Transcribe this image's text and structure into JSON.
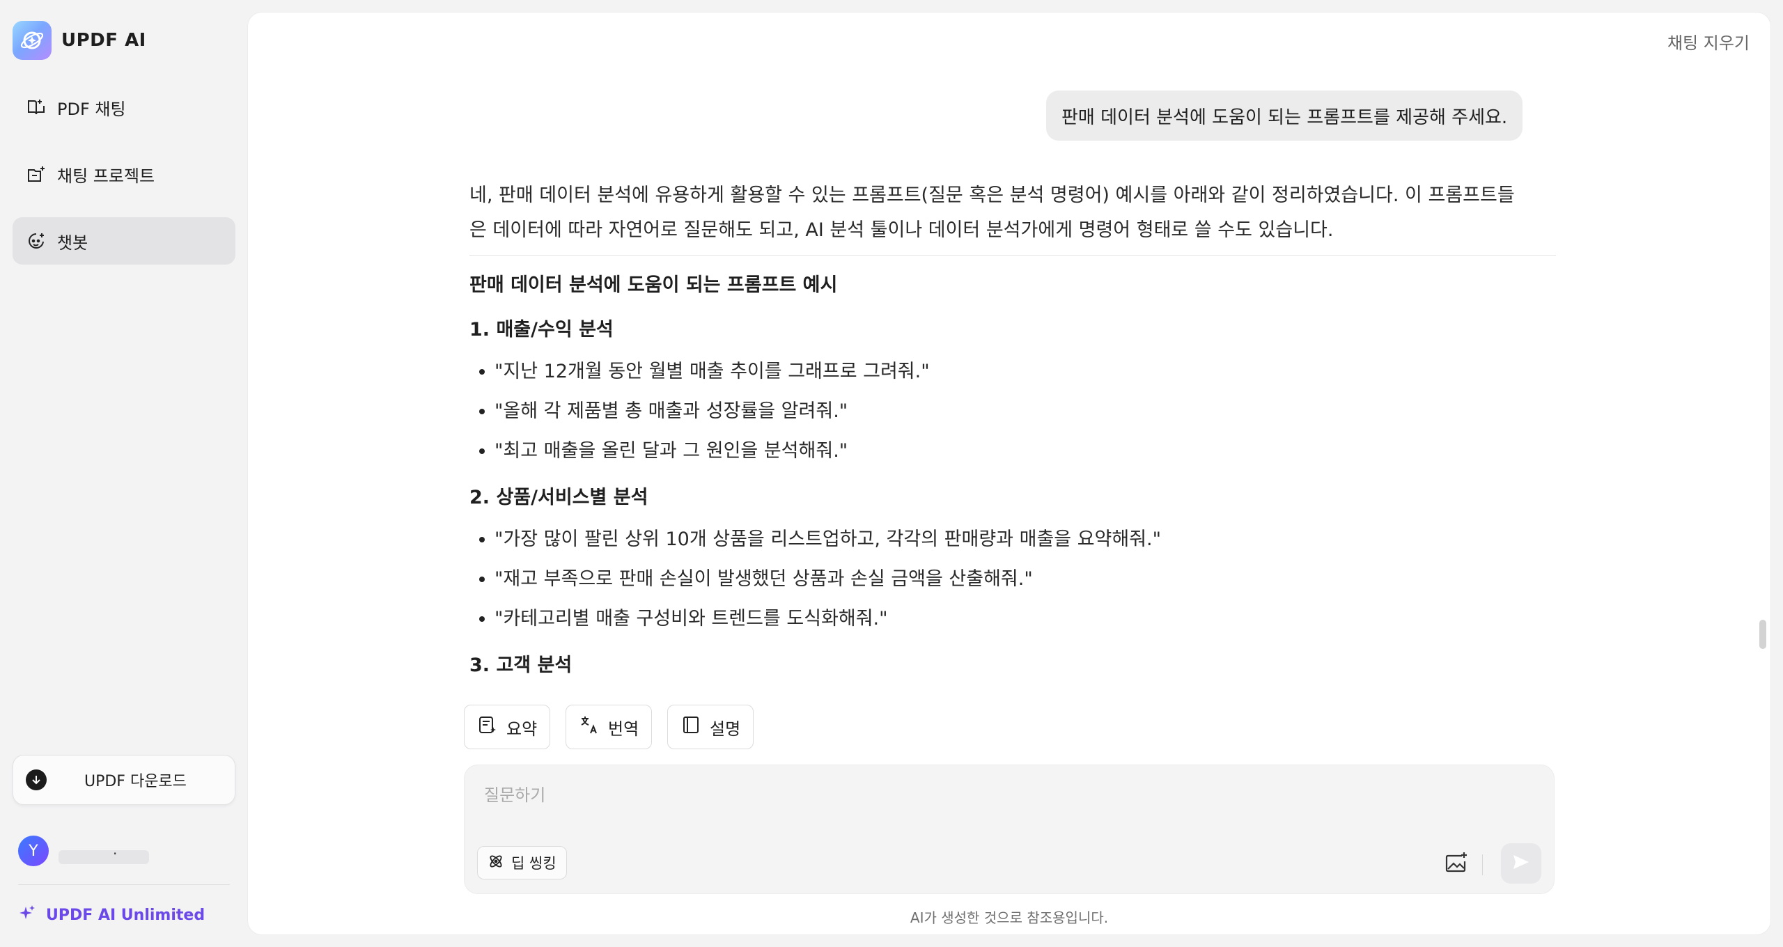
{
  "sidebar": {
    "brand": "UPDF AI",
    "nav": [
      {
        "label": "PDF 채팅",
        "icon": "book-open-icon"
      },
      {
        "label": "채팅 프로젝트",
        "icon": "folder-plus-icon"
      },
      {
        "label": "챗봇",
        "icon": "chatbot-icon",
        "active": true
      }
    ],
    "download_label": "UPDF 다운로드",
    "user": {
      "initial": "Y",
      "name_dot": "."
    },
    "unlimited_label": "UPDF AI Unlimited"
  },
  "header": {
    "clear_chat": "채팅 지우기"
  },
  "conversation": {
    "user_message": "판매 데이터 분석에 도움이 되는 프롬프트를 제공해 주세요.",
    "intro_line1": "네, 판매 데이터 분석에 유용하게 활용할 수 있는 프롬프트(질문 혹은 분석 명령어) 예시를 아래와 같이 정리하였습니다. 이 프롬프트들",
    "intro_line2": "은 데이터에 따라 자연어로 질문해도 되고, AI 분석 툴이나 데이터 분석가에게 명령어 형태로 쓸 수도 있습니다.",
    "title": "판매 데이터 분석에 도움이 되는 프롬프트 예시",
    "sections": [
      {
        "heading": "1. 매출/수익 분석",
        "items": [
          "\"지난 12개월 동안 월별 매출 추이를 그래프로 그려줘.\"",
          "\"올해 각 제품별 총 매출과 성장률을 알려줘.\"",
          "\"최고 매출을 올린 달과 그 원인을 분석해줘.\""
        ]
      },
      {
        "heading": "2. 상품/서비스별 분석",
        "items": [
          "\"가장 많이 팔린 상위 10개 상품을 리스트업하고, 각각의 판매량과 매출을 요약해줘.\"",
          "\"재고 부족으로 판매 손실이 발생했던 상품과 손실 금액을 산출해줘.\"",
          "\"카테고리별 매출 구성비와 트렌드를 도식화해줘.\""
        ]
      },
      {
        "heading": "3. 고객 분석",
        "items": []
      }
    ]
  },
  "quick_actions": [
    {
      "label": "요약",
      "icon": "summary-icon"
    },
    {
      "label": "번역",
      "icon": "translate-icon"
    },
    {
      "label": "설명",
      "icon": "book-icon"
    }
  ],
  "composer": {
    "placeholder": "질문하기",
    "deep_think_label": "딥 씽킹"
  },
  "footer": {
    "disclaimer": "AI가 생성한 것으로 참조용입니다."
  },
  "colors": {
    "accent": "#6a49e8",
    "active_nav": "#e3e3e6",
    "bubble": "#ececec"
  }
}
